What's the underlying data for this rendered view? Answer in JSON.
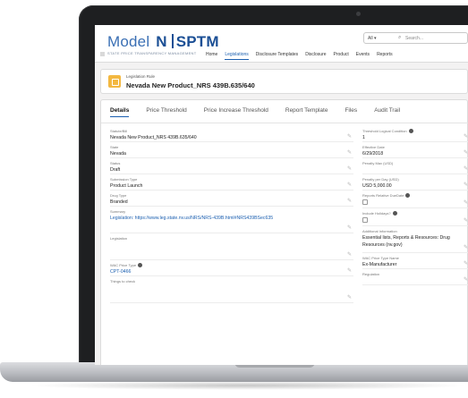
{
  "app": {
    "logo_model": "Model",
    "logo_n": "N",
    "logo_sptm": "SPTM",
    "tagline": "STATE PRICE TRANSPARENCY MANAGEMENT"
  },
  "search": {
    "scope": "All ▾",
    "placeholder": "Search..."
  },
  "nav": [
    "Home",
    "Legislations",
    "Disclosure Templates",
    "Disclosure",
    "Product",
    "Events",
    "Reports"
  ],
  "record": {
    "type": "Legislation Rule",
    "name": "Nevada New Product_NRS 439B.635/640"
  },
  "tabs": [
    "Details",
    "Price Threshold",
    "Price Increase Threshold",
    "Report Template",
    "Files",
    "Audit Trail"
  ],
  "left_fields": [
    {
      "label": "Statute/Bill",
      "value": "Nevada New Product_NRS 439B.635/640"
    },
    {
      "label": "State",
      "value": "Nevada"
    },
    {
      "label": "Status",
      "value": "Draft"
    },
    {
      "label": "Submission Type",
      "value": "Product Launch"
    },
    {
      "label": "Drug Type",
      "value": "Branded"
    },
    {
      "label": "Summary",
      "value": "Legislation: https://www.leg.state.nv.us/NRS/NRS-439B.html#NRS439BSec635"
    },
    {
      "label": "Legislation",
      "value": ""
    },
    {
      "label": "WAC Price Type",
      "value": "CPT-0466"
    },
    {
      "label": "Things to check",
      "value": ""
    }
  ],
  "right_fields": [
    {
      "label": "Threshold Logical Condition",
      "value": "1"
    },
    {
      "label": "Effective Date",
      "value": "6/29/2018"
    },
    {
      "label": "Penalty Max (USD)",
      "value": ""
    },
    {
      "label": "Penalty per Day (USD)",
      "value": "USD 5,000.00"
    },
    {
      "label": "Reports Relative DueDate",
      "value": ""
    },
    {
      "label": "Include Holidays?",
      "value": ""
    },
    {
      "label": "Additional Information",
      "value": "Essential lists, Reports & Resources: Drug Resources (nv.gov)"
    },
    {
      "label": "WAC Price Type Name",
      "value": "Ex-Manufacturer"
    },
    {
      "label": "Regulation",
      "value": ""
    }
  ],
  "colors": {
    "brand": "#1b4f95",
    "accent": "#1b5fb0",
    "record_icon": "#f3b841"
  }
}
